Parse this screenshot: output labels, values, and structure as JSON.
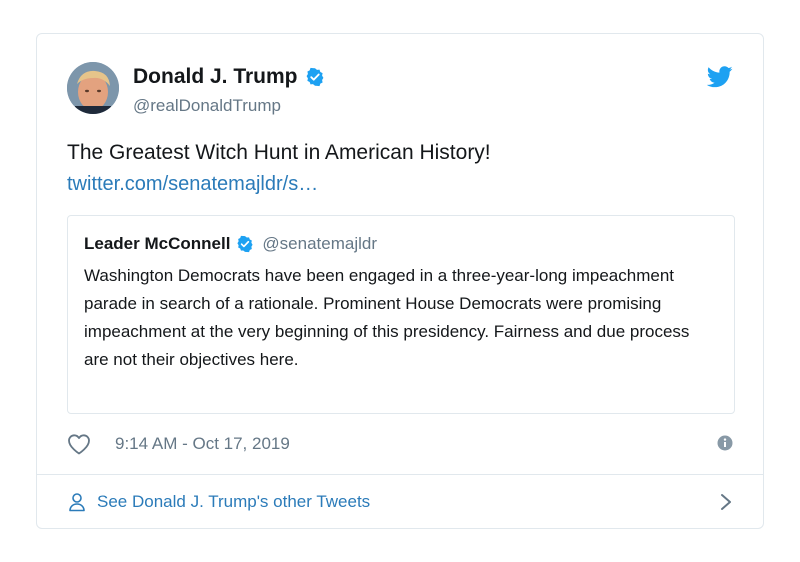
{
  "tweet": {
    "author_name": "Donald J. Trump",
    "author_handle": "@realDonaldTrump",
    "text": "The Greatest Witch Hunt in American History!",
    "link": "twitter.com/senatemajldr/s…",
    "timestamp": "9:14 AM - Oct 17, 2019"
  },
  "quoted_tweet": {
    "author_name": "Leader McConnell",
    "author_handle": "@senatemajldr",
    "text": "Washington Democrats have been engaged in a three-year-long impeachment parade in search of a rationale. Prominent House Democrats were promising impeachment at the very beginning of this presidency. Fairness and due process are not their objectives here."
  },
  "footer": {
    "label": "See Donald J. Trump's other Tweets"
  },
  "icons": {
    "verified": "verified-badge-icon",
    "brand": "twitter-bird-icon",
    "like": "heart-icon",
    "info": "info-icon",
    "profile": "person-icon",
    "chevron": "chevron-right-icon"
  },
  "colors": {
    "brand_blue": "#1da1f2",
    "link_blue": "#2b7bb9",
    "muted": "#657786",
    "border": "#e1e8ed"
  }
}
